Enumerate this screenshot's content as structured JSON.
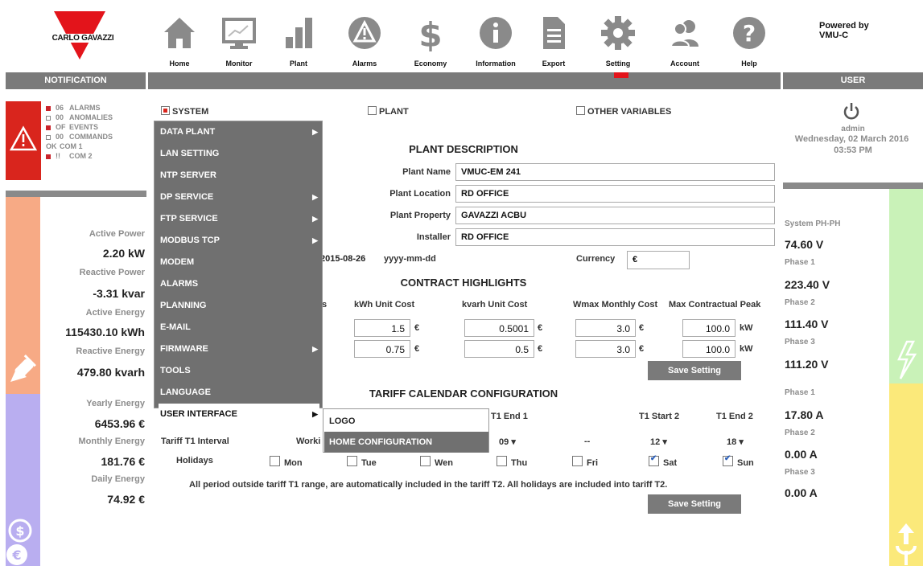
{
  "brand": {
    "logo_text": "CARLO GAVAZZI",
    "powered_by": "Powered by\nVMU-C",
    "accent": "#e3141b"
  },
  "nav": [
    {
      "label": "Home",
      "icon": "home-icon"
    },
    {
      "label": "Monitor",
      "icon": "monitor-icon"
    },
    {
      "label": "Plant",
      "icon": "plant-icon"
    },
    {
      "label": "Alarms",
      "icon": "alarm-icon"
    },
    {
      "label": "Economy",
      "icon": "dollar-icon"
    },
    {
      "label": "Information",
      "icon": "info-icon"
    },
    {
      "label": "Export",
      "icon": "export-icon"
    },
    {
      "label": "Setting",
      "icon": "gear-icon"
    },
    {
      "label": "Account",
      "icon": "account-icon"
    },
    {
      "label": "Help",
      "icon": "help-icon"
    }
  ],
  "bars": {
    "notification": "NOTIFICATION",
    "user": "USER"
  },
  "notifications": [
    {
      "state": "red",
      "count": "06",
      "label": "ALARMS"
    },
    {
      "state": "empty",
      "count": "00",
      "label": "ANOMALIES"
    },
    {
      "state": "red",
      "count": "OF",
      "label": "EVENTS"
    },
    {
      "state": "empty",
      "count": "00",
      "label": "COMMANDS"
    },
    {
      "state": "green",
      "count": "OK",
      "label": "COM 1"
    },
    {
      "state": "red",
      "count": "!!",
      "label": "COM 2"
    }
  ],
  "left_metrics": {
    "active_power_label": "Active Power",
    "active_power": "2.20 kW",
    "reactive_power_label": "Reactive Power",
    "reactive_power": "-3.31 kvar",
    "active_energy_label": "Active Energy",
    "active_energy": "115430.10 kWh",
    "reactive_energy_label": "Reactive Energy",
    "reactive_energy": "479.80 kvarh",
    "yearly_label": "Yearly Energy",
    "yearly": "6453.96 €",
    "monthly_label": "Monthly Energy",
    "monthly": "181.76 €",
    "daily_label": "Daily Energy",
    "daily": "74.92 €"
  },
  "user": {
    "name": "admin",
    "date": "Wednesday, 02 March 2016",
    "time": "03:53 PM"
  },
  "right_metrics": {
    "sys_label": "System PH-PH",
    "sys": "74.60 V",
    "ph1v_label": "Phase 1",
    "ph1v": "223.40 V",
    "ph2v_label": "Phase 2",
    "ph2v": "111.40 V",
    "ph3v_label": "Phase 3",
    "ph3v": "111.20 V",
    "ph1a_label": "Phase 1",
    "ph1a": "17.80 A",
    "ph2a_label": "Phase 2",
    "ph2a": "0.00 A",
    "ph3a_label": "Phase 3",
    "ph3a": "0.00 A"
  },
  "tabs": {
    "system": "SYSTEM",
    "plant": "PLANT",
    "other": "OTHER VARIABLES"
  },
  "plant": {
    "title": "PLANT DESCRIPTION",
    "name_label": "Plant Name",
    "name": "VMUC-EM 241",
    "location_label": "Plant Location",
    "location": "RD OFFICE",
    "property_label": "Plant Property",
    "property": "GAVAZZI ACBU",
    "installer_label": "Installer",
    "installer": "RD OFFICE",
    "date_value": "2015-08-26",
    "date_fmt": "yyyy-mm-dd",
    "currency_label": "Currency",
    "currency": "€"
  },
  "contract": {
    "title": "CONTRACT HIGHLIGHTS",
    "col_partial": "s",
    "col_kwh": "kWh Unit Cost",
    "col_kvarh": "kvarh Unit Cost",
    "col_wmax": "Wmax Monthly Cost",
    "col_peak": "Max Contractual Peak",
    "row1": {
      "kwh": "1.5",
      "kvarh": "0.5001",
      "wmax": "3.0",
      "peak": "100.0"
    },
    "row2": {
      "kwh": "0.75",
      "kvarh": "0.5",
      "wmax": "3.0",
      "peak": "100.0"
    },
    "euro": "€",
    "kw": "kW",
    "save": "Save Setting"
  },
  "tariff": {
    "title": "TARIFF CALENDAR CONFIGURATION",
    "t1_end1": "T1 End 1",
    "t1_start2": "T1 Start 2",
    "t1_end2": "T1 End 2",
    "interval_label": "Tariff T1 Interval",
    "working_partial": "Worki",
    "end1": "09",
    "dash": "--",
    "start2": "12",
    "end2": "18",
    "holidays_label": "Holidays",
    "days": [
      {
        "label": "Mon",
        "checked": false
      },
      {
        "label": "Tue",
        "checked": false
      },
      {
        "label": "Wen",
        "checked": false
      },
      {
        "label": "Thu",
        "checked": false
      },
      {
        "label": "Fri",
        "checked": false
      },
      {
        "label": "Sat",
        "checked": true
      },
      {
        "label": "Sun",
        "checked": true
      }
    ],
    "note": "All period outside tariff T1 range, are automatically included in the tariff T2. All holidays are included into tariff T2.",
    "save": "Save Setting"
  },
  "menu": {
    "items": [
      {
        "label": "DATA PLANT",
        "sub": true
      },
      {
        "label": "LAN SETTING",
        "sub": false
      },
      {
        "label": "NTP SERVER",
        "sub": false
      },
      {
        "label": "DP SERVICE",
        "sub": true
      },
      {
        "label": "FTP SERVICE",
        "sub": true
      },
      {
        "label": "MODBUS TCP",
        "sub": true
      },
      {
        "label": "MODEM",
        "sub": false
      },
      {
        "label": "ALARMS",
        "sub": false
      },
      {
        "label": "PLANNING",
        "sub": false
      },
      {
        "label": "E-MAIL",
        "sub": false
      },
      {
        "label": "FIRMWARE",
        "sub": true
      },
      {
        "label": "TOOLS",
        "sub": false
      },
      {
        "label": "LANGUAGE",
        "sub": false
      },
      {
        "label": "USER INTERFACE",
        "sub": true
      }
    ],
    "submenu": [
      {
        "label": "LOGO"
      },
      {
        "label": "HOME CONFIGURATION"
      }
    ]
  }
}
